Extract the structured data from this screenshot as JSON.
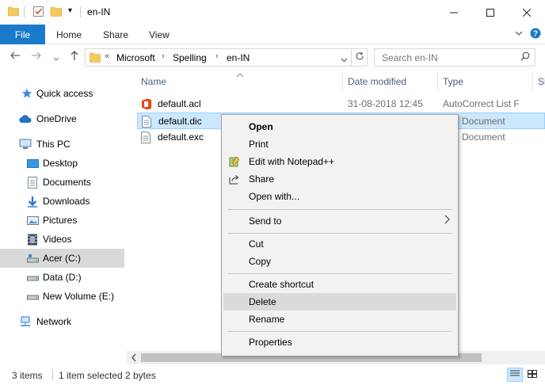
{
  "window": {
    "title": "en-IN",
    "minimize_icon": "minimize-icon",
    "maximize_icon": "maximize-icon",
    "close_icon": "close-icon",
    "quick_access_dropdown": "▾"
  },
  "ribbon": {
    "tabs": [
      "File",
      "Home",
      "Share",
      "View"
    ],
    "file_color": "#1979ca"
  },
  "address": {
    "overflow": "«",
    "crumbs": [
      "Microsoft",
      "Spelling",
      "en-IN"
    ],
    "search_placeholder": "Search en-IN"
  },
  "navpane": {
    "items": [
      {
        "label": "Quick access",
        "icon": "star-icon"
      },
      {
        "label": "OneDrive",
        "icon": "cloud-icon"
      },
      {
        "label": "This PC",
        "icon": "computer-icon"
      },
      {
        "label": "Desktop",
        "icon": "desktop-folder-icon"
      },
      {
        "label": "Documents",
        "icon": "documents-folder-icon"
      },
      {
        "label": "Downloads",
        "icon": "download-arrow-icon"
      },
      {
        "label": "Pictures",
        "icon": "pictures-folder-icon"
      },
      {
        "label": "Videos",
        "icon": "videos-folder-icon"
      },
      {
        "label": "Acer (C:)",
        "icon": "drive-icon"
      },
      {
        "label": "Data (D:)",
        "icon": "drive-icon"
      },
      {
        "label": "New Volume (E:)",
        "icon": "drive-icon"
      },
      {
        "label": "Network",
        "icon": "network-icon"
      }
    ]
  },
  "columns": {
    "name": "Name",
    "date": "Date modified",
    "type": "Type",
    "size": "Si"
  },
  "files": [
    {
      "name": "default.acl",
      "date": "31-08-2018 12:45",
      "type": "AutoCorrect List F",
      "icon": "office-icon"
    },
    {
      "name": "default.dic",
      "date": "",
      "type": "Document",
      "icon": "text-file-icon"
    },
    {
      "name": "default.exc",
      "date": "",
      "type": "Document",
      "icon": "text-file-icon"
    }
  ],
  "context_menu": {
    "items": [
      {
        "label": "Open",
        "bold": true,
        "icon": ""
      },
      {
        "label": "Print",
        "icon": ""
      },
      {
        "label": "Edit with Notepad++",
        "icon": "notepad-plus-icon"
      },
      {
        "label": "Share",
        "icon": "share-icon"
      },
      {
        "label": "Open with...",
        "icon": ""
      },
      {
        "label": "Send to",
        "icon": "",
        "submenu": true
      },
      {
        "label": "Cut",
        "icon": ""
      },
      {
        "label": "Copy",
        "icon": ""
      },
      {
        "label": "Create shortcut",
        "icon": ""
      },
      {
        "label": "Delete",
        "icon": "",
        "highlighted": true
      },
      {
        "label": "Rename",
        "icon": ""
      },
      {
        "label": "Properties",
        "icon": ""
      }
    ],
    "submenu_arrow": "›"
  },
  "status": {
    "items_count": "3 items",
    "selection": "1 item selected",
    "size": "2 bytes"
  }
}
